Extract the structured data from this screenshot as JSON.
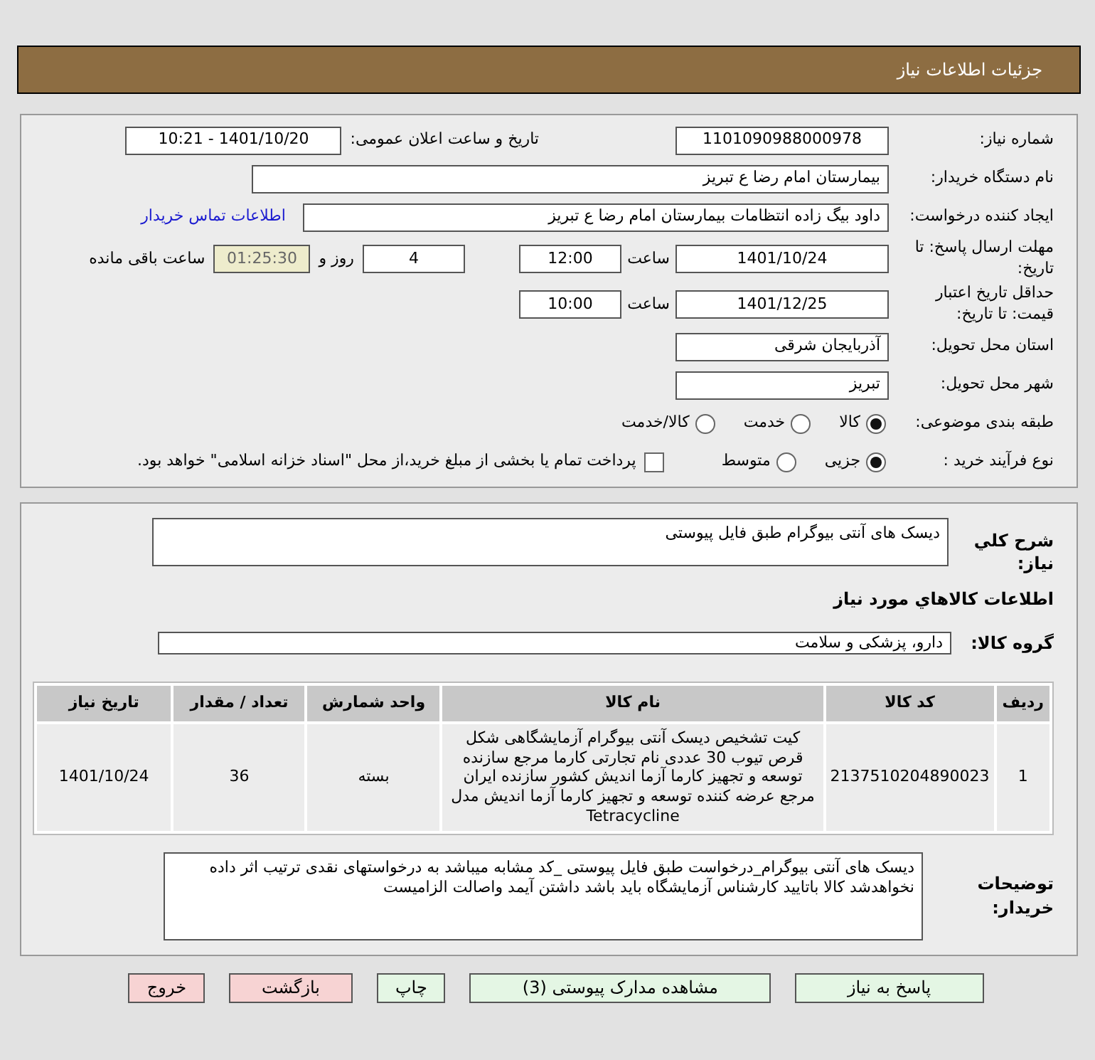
{
  "header": {
    "title": "جزئیات اطلاعات نیاز"
  },
  "need_number": {
    "label": "شماره نیاز:",
    "value": "1101090988000978"
  },
  "announce_datetime": {
    "label": "تاریخ و ساعت اعلان عمومی:",
    "value": "1401/10/20 - 10:21"
  },
  "buyer_org": {
    "label": "نام دستگاه خریدار:",
    "value": "بیمارستان امام رضا  ع  تبریز"
  },
  "requester": {
    "label": "ایجاد کننده درخواست:",
    "value": "داود بیگ زاده انتظامات بیمارستان امام رضا  ع  تبریز",
    "contact_link": "اطلاعات تماس خریدار"
  },
  "response_deadline": {
    "label": "مهلت ارسال پاسخ: تا تاریخ:",
    "date": "1401/10/24",
    "time_label": "ساعت",
    "time": "12:00",
    "days": "4",
    "days_label": "روز و",
    "remaining": "01:25:30",
    "remaining_label": "ساعت باقی مانده"
  },
  "price_validity": {
    "label": "حداقل تاریخ اعتبار قیمت: تا تاریخ:",
    "date": "1401/12/25",
    "time_label": "ساعت",
    "time": "10:00"
  },
  "delivery_province": {
    "label": "استان محل تحویل:",
    "value": "آذربایجان شرقی"
  },
  "delivery_city": {
    "label": "شهر محل تحویل:",
    "value": "تبریز"
  },
  "category": {
    "label": "طبقه بندی موضوعی:",
    "options": [
      {
        "label": "کالا",
        "selected": true
      },
      {
        "label": "خدمت",
        "selected": false
      },
      {
        "label": "کالا/خدمت",
        "selected": false
      }
    ]
  },
  "purchase_process": {
    "label": "نوع فرآیند خرید :",
    "options": [
      {
        "label": "جزیی",
        "selected": true
      },
      {
        "label": "متوسط",
        "selected": false
      }
    ],
    "treasury_payment": {
      "label": "پرداخت تمام یا بخشی از مبلغ خرید،از محل \"اسناد خزانه اسلامی\" خواهد بود.",
      "checked": false
    }
  },
  "summary": {
    "label": "شرح کلي نياز:",
    "value": "دیسک های آنتی بیوگرام طبق فایل پیوستی"
  },
  "goods_heading": "اطلاعات کالاهاي مورد نياز",
  "goods_group": {
    "label": "گروه کالا:",
    "value": "دارو، پزشکی و سلامت"
  },
  "goods_table": {
    "columns": [
      "ردیف",
      "کد کالا",
      "نام کالا",
      "واحد شمارش",
      "تعداد / مقدار",
      "تاریخ نیاز"
    ],
    "rows": [
      [
        "1",
        "2137510204890023",
        "کیت تشخیص دیسک آنتی بیوگرام آزمایشگاهی شکل قرص تیوب 30 عددی نام تجارتی کارما مرجع سازنده توسعه و تجهیز کارما آزما اندیش کشور سازنده ایران مرجع عرضه کننده توسعه و تجهیز کارما آزما اندیش مدل Tetracycline",
        "بسته",
        "36",
        "1401/10/24"
      ]
    ]
  },
  "buyer_notes": {
    "label": "توضیحات خریدار:",
    "value": "دیسک های آنتی بیوگرام_درخواست طبق فایل پیوستی _کد مشابه میباشد به درخواستهای نقدی ترتیب اثر داده نخواهدشد کالا باتایید کارشناس آزمایشگاه باید باشد داشتن آیمد واصالت الزامیست"
  },
  "buttons": [
    {
      "label": "پاسخ به نیاز",
      "kind": "action"
    },
    {
      "label": "مشاهده مدارک پیوستی (3)",
      "kind": "action"
    },
    {
      "label": "چاپ",
      "kind": "action"
    },
    {
      "label": "بازگشت",
      "kind": "exit"
    },
    {
      "label": "خروج",
      "kind": "exit"
    }
  ]
}
